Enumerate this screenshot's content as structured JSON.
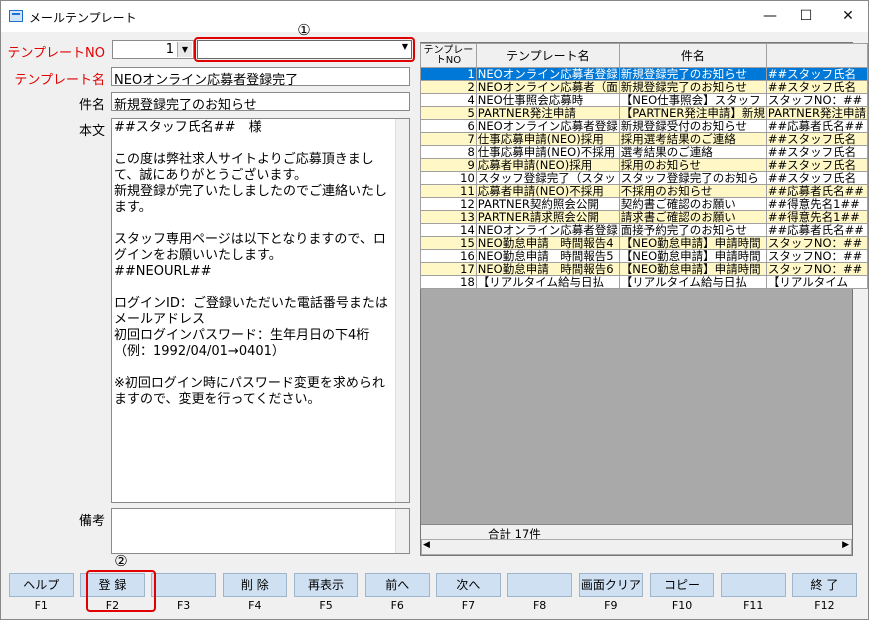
{
  "window": {
    "title": "メールテンプレート",
    "minimize": "—",
    "maximize": "☐",
    "close": "✕"
  },
  "form": {
    "template_no_label": "テンプレートNO",
    "template_no_value": "1",
    "template_name_label": "テンプレート名",
    "template_name_value": "NEOオンライン応募者登録完了",
    "subject_label": "件名",
    "subject_value": "新規登録完了のお知らせ",
    "body_label": "本文",
    "body_value": "##スタッフ氏名##　様\n\nこの度は弊社求人サイトよりご応募頂きまして、誠にありがとうございます。\n新規登録が完了いたしましたのでご連絡いたします。\n\nスタッフ専用ページは以下となりますので、ログインをお願いいたします。\n##NEOURL##\n\nログインID：ご登録いただいた電話番号またはメールアドレス\n初回ログインパスワード：生年月日の下4桁\n（例：1992/04/01→0401）\n\n※初回ログイン時にパスワード変更を求められますので、変更を行ってください。",
    "note_label": "備考"
  },
  "annotations": {
    "one": "①",
    "two": "②"
  },
  "grid": {
    "headers": [
      "テンプレートNO",
      "テンプレート名",
      "件名"
    ],
    "rows": [
      [
        "1",
        "NEOオンライン応募者登録",
        "新規登録完了のお知らせ",
        "##スタッフ氏名"
      ],
      [
        "2",
        "NEOオンライン応募者（面",
        "新規登録完了のお知らせ",
        "##スタッフ氏名"
      ],
      [
        "4",
        "NEO仕事照会応募時",
        "【NEO仕事照会】スタッフ",
        "スタッフNO：##"
      ],
      [
        "5",
        "PARTNER発注申請",
        "【PARTNER発注申請】新規",
        "PARTNER発注申請"
      ],
      [
        "6",
        "NEOオンライン応募者登録",
        "新規登録受付のお知らせ",
        "##応募者氏名##"
      ],
      [
        "7",
        "仕事応募申請(NEO)採用",
        "採用選考結果のご連絡",
        "##スタッフ氏名"
      ],
      [
        "8",
        "仕事応募申請(NEO)不採用",
        "選考結果のご連絡",
        "##スタッフ氏名"
      ],
      [
        "9",
        "応募者申請(NEO)採用",
        "採用のお知らせ",
        "##スタッフ氏名"
      ],
      [
        "10",
        "スタッフ登録完了（スタッ",
        "スタッフ登録完了のお知ら",
        "##スタッフ氏名"
      ],
      [
        "11",
        "応募者申請(NEO)不採用",
        "不採用のお知らせ",
        "##応募者氏名##"
      ],
      [
        "12",
        "PARTNER契約照会公開",
        "契約書ご確認のお願い",
        "##得意先名1##"
      ],
      [
        "13",
        "PARTNER請求照会公開",
        "請求書ご確認のお願い",
        "##得意先名1##"
      ],
      [
        "14",
        "NEOオンライン応募者登録",
        "面接予約完了のお知らせ",
        "##応募者氏名##"
      ],
      [
        "15",
        "NEO勤怠申請　時間報告4",
        "【NEO勤怠申請】申請時間",
        "スタッフNO：##"
      ],
      [
        "16",
        "NEO勤怠申請　時間報告5",
        "【NEO勤怠申請】申請時間",
        "スタッフNO：##"
      ],
      [
        "17",
        "NEO勤怠申請　時間報告6",
        "【NEO勤怠申請】申請時間",
        "スタッフNO：##"
      ],
      [
        "18",
        "【リアルタイム給与日払",
        "【リアルタイム給与日払",
        "【リアルタイム"
      ]
    ],
    "total": "合計 17件"
  },
  "fkeys": [
    {
      "label": "ヘルプ",
      "key": "F1"
    },
    {
      "label": "登 録",
      "key": "F2"
    },
    {
      "label": "",
      "key": "F3"
    },
    {
      "label": "削 除",
      "key": "F4"
    },
    {
      "label": "再表示",
      "key": "F5"
    },
    {
      "label": "前へ",
      "key": "F6"
    },
    {
      "label": "次へ",
      "key": "F7"
    },
    {
      "label": "",
      "key": "F8"
    },
    {
      "label": "画面クリア",
      "key": "F9"
    },
    {
      "label": "コピー",
      "key": "F10"
    },
    {
      "label": "",
      "key": "F11"
    },
    {
      "label": "終 了",
      "key": "F12"
    }
  ],
  "colors": {
    "selected_row": "#0078d7",
    "yellow_row": "#fff8c6",
    "white_row": "#ffffff",
    "fkey_button": "#cfe0f3",
    "label_red": "#e00000"
  }
}
